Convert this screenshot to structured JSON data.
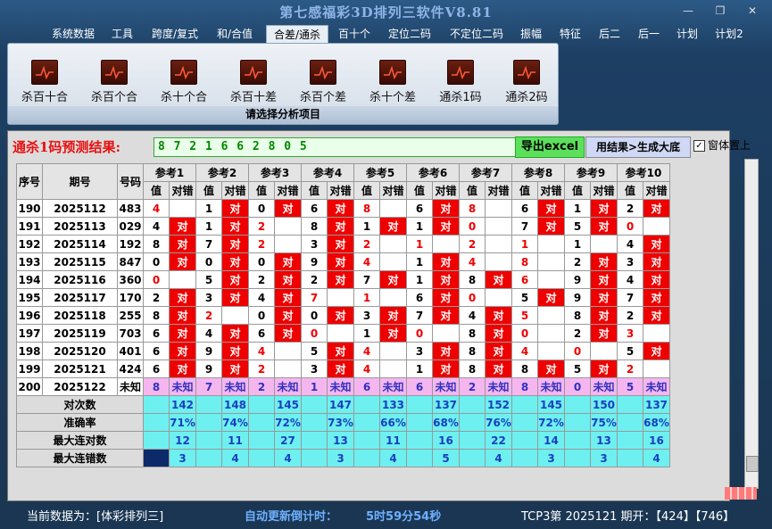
{
  "window": {
    "title": "第七感福彩3D排列三软件V8.81"
  },
  "menu": [
    "系统数据",
    "工具",
    "跨度/复式",
    "和/合值",
    "合差/通杀",
    "百十个",
    "定位二码",
    "不定位二码",
    "振幅",
    "特征",
    "后二",
    "后一",
    "计划",
    "计划2"
  ],
  "menu_active": "合差/通杀",
  "ribbon": {
    "buttons": [
      "杀百十合",
      "杀百个合",
      "杀十个合",
      "杀百十差",
      "杀百个差",
      "杀十个差",
      "通杀1码",
      "通杀2码"
    ],
    "footer": "请选择分析项目"
  },
  "prediction": {
    "label": "通杀1码预测结果:",
    "value": "8 7 2 1 6 6 2 8 0 5",
    "export_btn": "导出excel",
    "generate_btn": "用结果>生成大底",
    "topmost_label": "窗体置上",
    "topmost_checked": true
  },
  "table": {
    "col_seq": "序号",
    "col_period": "期号",
    "col_code": "号码",
    "ref_headers": [
      "参考1",
      "参考2",
      "参考3",
      "参考4",
      "参考5",
      "参考6",
      "参考7",
      "参考8",
      "参考9",
      "参考10"
    ],
    "sub_val": "值",
    "sub_hit": "对错",
    "hit_mark": "对",
    "unknown_mark": "未知",
    "rows": [
      {
        "seq": "190",
        "period": "2025112",
        "code": "483",
        "vals": [
          "4",
          "1",
          "0",
          "6",
          "8",
          "6",
          "8",
          "6",
          "1",
          "2"
        ],
        "hits": [
          0,
          1,
          1,
          1,
          0,
          1,
          0,
          1,
          1,
          1
        ],
        "red": [
          1,
          0,
          0,
          0,
          1,
          0,
          1,
          0,
          0,
          0
        ]
      },
      {
        "seq": "191",
        "period": "2025113",
        "code": "029",
        "vals": [
          "4",
          "1",
          "2",
          "8",
          "1",
          "1",
          "0",
          "7",
          "5",
          "0"
        ],
        "hits": [
          1,
          1,
          0,
          1,
          1,
          1,
          0,
          1,
          1,
          0
        ],
        "red": [
          0,
          0,
          1,
          0,
          0,
          0,
          1,
          0,
          0,
          1
        ]
      },
      {
        "seq": "192",
        "period": "2025114",
        "code": "192",
        "vals": [
          "8",
          "7",
          "2",
          "3",
          "2",
          "1",
          "2",
          "1",
          "1",
          "4"
        ],
        "hits": [
          1,
          1,
          0,
          1,
          0,
          0,
          0,
          0,
          0,
          1
        ],
        "red": [
          0,
          0,
          1,
          0,
          1,
          1,
          1,
          1,
          0,
          0
        ]
      },
      {
        "seq": "193",
        "period": "2025115",
        "code": "847",
        "vals": [
          "0",
          "0",
          "0",
          "9",
          "4",
          "1",
          "4",
          "8",
          "2",
          "3"
        ],
        "hits": [
          1,
          1,
          1,
          1,
          0,
          1,
          0,
          0,
          1,
          1
        ],
        "red": [
          0,
          0,
          0,
          0,
          1,
          0,
          1,
          1,
          0,
          0
        ]
      },
      {
        "seq": "194",
        "period": "2025116",
        "code": "360",
        "vals": [
          "0",
          "5",
          "2",
          "2",
          "7",
          "1",
          "8",
          "6",
          "9",
          "4"
        ],
        "hits": [
          0,
          1,
          1,
          1,
          1,
          1,
          1,
          0,
          1,
          1
        ],
        "red": [
          1,
          0,
          0,
          0,
          0,
          0,
          0,
          1,
          0,
          0
        ]
      },
      {
        "seq": "195",
        "period": "2025117",
        "code": "170",
        "vals": [
          "2",
          "3",
          "4",
          "7",
          "1",
          "6",
          "0",
          "5",
          "9",
          "7"
        ],
        "hits": [
          1,
          1,
          1,
          0,
          0,
          1,
          0,
          1,
          1,
          1
        ],
        "red": [
          0,
          0,
          0,
          1,
          1,
          0,
          1,
          0,
          0,
          0
        ]
      },
      {
        "seq": "196",
        "period": "2025118",
        "code": "255",
        "vals": [
          "8",
          "2",
          "0",
          "0",
          "3",
          "7",
          "4",
          "5",
          "8",
          "2"
        ],
        "hits": [
          1,
          0,
          1,
          1,
          1,
          1,
          1,
          0,
          1,
          1
        ],
        "red": [
          0,
          1,
          0,
          0,
          0,
          0,
          0,
          1,
          0,
          0
        ]
      },
      {
        "seq": "197",
        "period": "2025119",
        "code": "703",
        "vals": [
          "6",
          "4",
          "6",
          "0",
          "1",
          "0",
          "8",
          "0",
          "2",
          "3"
        ],
        "hits": [
          1,
          1,
          1,
          0,
          1,
          0,
          1,
          0,
          1,
          0
        ],
        "red": [
          0,
          0,
          0,
          1,
          0,
          1,
          0,
          1,
          0,
          1
        ]
      },
      {
        "seq": "198",
        "period": "2025120",
        "code": "401",
        "vals": [
          "6",
          "9",
          "4",
          "5",
          "4",
          "3",
          "8",
          "4",
          "0",
          "5"
        ],
        "hits": [
          1,
          1,
          0,
          1,
          0,
          1,
          1,
          0,
          0,
          1
        ],
        "red": [
          0,
          0,
          1,
          0,
          1,
          0,
          0,
          1,
          1,
          0
        ]
      },
      {
        "seq": "199",
        "period": "2025121",
        "code": "424",
        "vals": [
          "6",
          "9",
          "2",
          "3",
          "4",
          "1",
          "8",
          "8",
          "5",
          "2"
        ],
        "hits": [
          1,
          1,
          0,
          1,
          0,
          1,
          1,
          1,
          1,
          0
        ],
        "red": [
          0,
          0,
          1,
          0,
          1,
          0,
          0,
          0,
          0,
          1
        ]
      }
    ],
    "unknown_row": {
      "seq": "200",
      "period": "2025122",
      "code": "未知",
      "vals": [
        "8",
        "7",
        "2",
        "1",
        "6",
        "6",
        "2",
        "8",
        "0",
        "5"
      ]
    },
    "stats": [
      {
        "label": "对次数",
        "values": [
          "142",
          "148",
          "145",
          "147",
          "133",
          "137",
          "152",
          "145",
          "150",
          "137"
        ]
      },
      {
        "label": "准确率",
        "values": [
          "71%",
          "74%",
          "72%",
          "73%",
          "66%",
          "68%",
          "76%",
          "72%",
          "75%",
          "68%"
        ]
      },
      {
        "label": "最大连对数",
        "values": [
          "12",
          "11",
          "27",
          "13",
          "11",
          "16",
          "22",
          "14",
          "13",
          "16"
        ]
      },
      {
        "label": "最大连错数",
        "values": [
          "3",
          "4",
          "4",
          "3",
          "4",
          "5",
          "4",
          "3",
          "3",
          "4"
        ]
      }
    ]
  },
  "status": {
    "data_label": "当前数据为：[体彩排列三]",
    "countdown_label": "自动更新倒计时：",
    "countdown_value": "5时59分54秒",
    "draw_info": "TCP3第 2025121 期开：【424】【746】"
  },
  "colors": {
    "hit": "#e00000",
    "unknown": "#f5b6f0",
    "stats": "#6ef0f0",
    "accent": "#3a6fc8"
  }
}
